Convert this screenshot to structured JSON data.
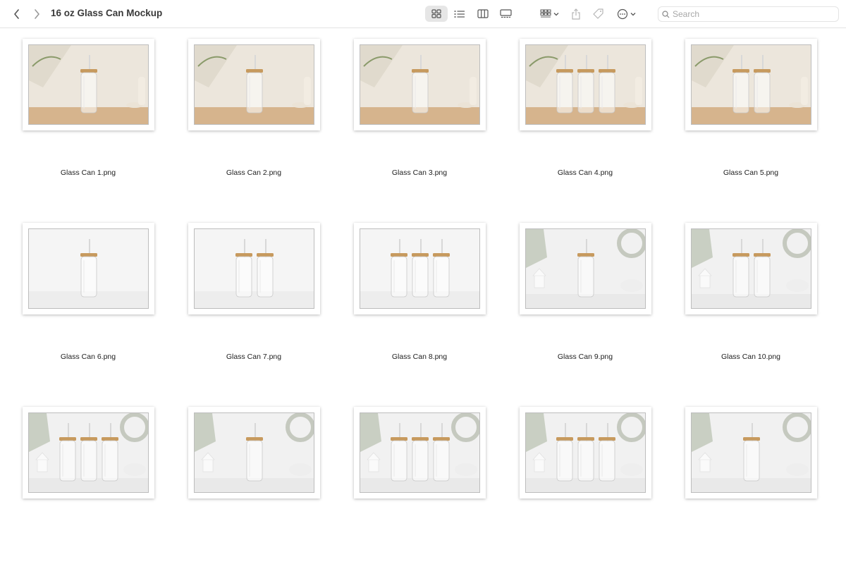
{
  "window": {
    "title": "16 oz Glass Can Mockup"
  },
  "toolbar": {
    "back_icon": "chevron-left-icon",
    "forward_icon": "chevron-right-icon",
    "views": [
      "icon-view-icon",
      "list-view-icon",
      "column-view-icon",
      "gallery-view-icon"
    ],
    "active_view": "icon-view-icon",
    "group_icon": "group-by-icon",
    "share_icon": "share-icon",
    "tags_icon": "tag-icon",
    "more_icon": "more-actions-icon"
  },
  "search": {
    "placeholder": "Search"
  },
  "files": [
    {
      "name": "Glass Can 1.png",
      "scene": "neutral",
      "cans": 1
    },
    {
      "name": "Glass Can 2.png",
      "scene": "neutral",
      "cans": 1
    },
    {
      "name": "Glass Can 3.png",
      "scene": "neutral",
      "cans": 1
    },
    {
      "name": "Glass Can 4.png",
      "scene": "neutral",
      "cans": 3
    },
    {
      "name": "Glass Can 5.png",
      "scene": "neutral",
      "cans": 2
    },
    {
      "name": "Glass Can 6.png",
      "scene": "white",
      "cans": 1
    },
    {
      "name": "Glass Can 7.png",
      "scene": "white",
      "cans": 2
    },
    {
      "name": "Glass Can 8.png",
      "scene": "white",
      "cans": 3
    },
    {
      "name": "Glass Can 9.png",
      "scene": "holiday",
      "cans": 1
    },
    {
      "name": "Glass Can 10.png",
      "scene": "holiday",
      "cans": 2
    },
    {
      "name": "",
      "scene": "holiday",
      "cans": 3
    },
    {
      "name": "",
      "scene": "holiday",
      "cans": 1
    },
    {
      "name": "",
      "scene": "holiday",
      "cans": 3
    },
    {
      "name": "",
      "scene": "holiday",
      "cans": 3
    },
    {
      "name": "",
      "scene": "holiday",
      "cans": 1
    }
  ],
  "colors": {
    "accent_active_view": "#e6e6e6",
    "lid": "#c79a5e",
    "wood": "#d6b48d",
    "wall_neutral": "#ece6dc"
  }
}
